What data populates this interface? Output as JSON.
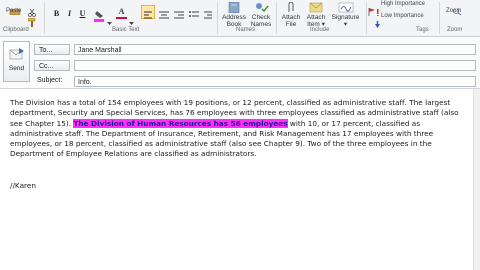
{
  "ribbon": {
    "paste_label": "Paste",
    "clipboard_label": "Clipboard",
    "basic_text_label": "Basic Text",
    "bold": "B",
    "italic": "I",
    "underline": "U",
    "font_color": "A",
    "address_book": [
      "Address",
      "Book"
    ],
    "check_names": [
      "Check",
      "Names"
    ],
    "names_label": "Names",
    "attach_file": [
      "Attach",
      "File"
    ],
    "attach_item": [
      "Attach",
      "Item ▾"
    ],
    "signature": [
      "Signature",
      "▾"
    ],
    "include_label": "Include",
    "high_importance": "High Importance",
    "low_importance": "Low Importance",
    "tags_label": "Tags",
    "zoom_label": "Zoom",
    "zoom_group_label": "Zoom",
    "highlight_color": "#ff2bff",
    "font_color_value": "#d0103a"
  },
  "header": {
    "send_label": "Send",
    "to_label": "To...",
    "to_value": "Jane Marshall",
    "cc_label": "Cc...",
    "cc_value": "",
    "subject_label": "Subject:",
    "subject_value": "Info."
  },
  "message": {
    "part1": "The Division has a total of 154 employees with 19 positions, or 12 percent, classified as administrative staff.  The largest department, Security and Special Services, has 76 employees with three employees classified as administrative staff (also see Chapter 15).  ",
    "highlighted": "The Division of Human Resources has 56 employees",
    "part2": " with 10, or 17 percent, classified as administrative staff.  The Department of Insurance, Retirement, and Risk Management has 17 employees with three employees, or 18 percent, classified as administrative staff (also see Chapter 9).  Two of the three employees in the Department of Employee Relations are classified as administrators.",
    "signature": "//Karen"
  }
}
